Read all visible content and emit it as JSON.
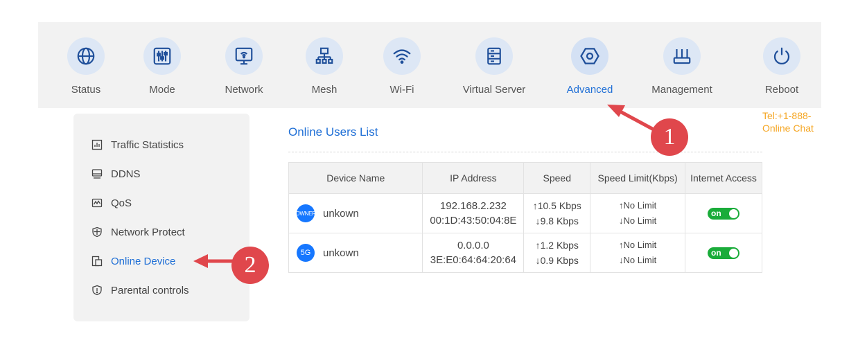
{
  "nav": {
    "items": [
      {
        "label": "Status",
        "icon": "globe-icon"
      },
      {
        "label": "Mode",
        "icon": "sliders-icon"
      },
      {
        "label": "Network",
        "icon": "monitor-icon"
      },
      {
        "label": "Mesh",
        "icon": "mesh-icon"
      },
      {
        "label": "Wi-Fi",
        "icon": "wifi-icon"
      },
      {
        "label": "Virtual Server",
        "icon": "server-icon"
      },
      {
        "label": "Advanced",
        "icon": "hexagon-icon",
        "active": true
      },
      {
        "label": "Management",
        "icon": "router-icon"
      },
      {
        "label": "Reboot",
        "icon": "power-icon"
      }
    ]
  },
  "contact": {
    "tel": "Tel:+1-888-",
    "chat": "Online Chat"
  },
  "sidebar": {
    "items": [
      {
        "label": "Traffic Statistics",
        "icon": "bar-chart-icon"
      },
      {
        "label": "DDNS",
        "icon": "ddns-icon"
      },
      {
        "label": "QoS",
        "icon": "qos-icon"
      },
      {
        "label": "Network Protect",
        "icon": "shield-plus-icon"
      },
      {
        "label": "Online Device",
        "icon": "device-icon",
        "active": true
      },
      {
        "label": "Parental controls",
        "icon": "shield-alert-icon"
      }
    ]
  },
  "main": {
    "title": "Online Users List",
    "table": {
      "headers": [
        "Device Name",
        "IP Address",
        "Speed",
        "Speed Limit(Kbps)",
        "Internet Access"
      ],
      "rows": [
        {
          "badge": "OWNER",
          "name": "unkown",
          "ip": "192.168.2.232",
          "mac": "00:1D:43:50:04:8E",
          "up_speed": "↑10.5 Kbps",
          "down_speed": "↓9.8 Kbps",
          "up_limit": "↑No Limit",
          "down_limit": "↓No Limit",
          "access": "on"
        },
        {
          "badge": "5G",
          "name": "unkown",
          "ip": "0.0.0.0",
          "mac": "3E:E0:64:64:20:64",
          "up_speed": "↑1.2 Kbps",
          "down_speed": "↓0.9 Kbps",
          "up_limit": "↑No Limit",
          "down_limit": "↓No Limit",
          "access": "on"
        }
      ]
    }
  },
  "callouts": {
    "first": "1",
    "second": "2"
  },
  "colors": {
    "accent": "#1f6fd6",
    "toggle_on": "#1aac3a",
    "callout": "#e0474c",
    "contact": "#f5a623"
  }
}
